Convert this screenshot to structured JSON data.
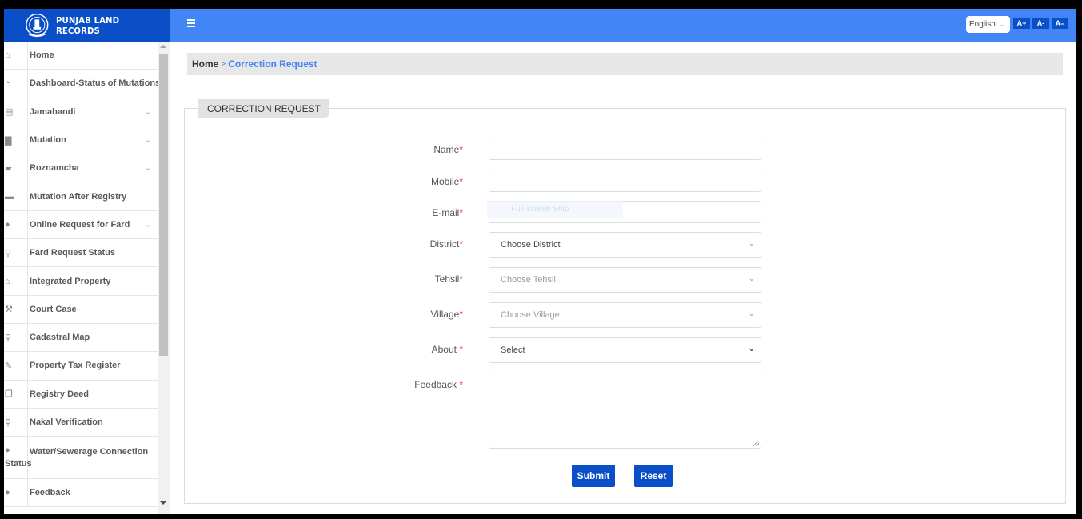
{
  "header": {
    "app_title": "PUNJAB LAND RECORDS",
    "emblem_icon": "state-emblem",
    "menu_icon": "hamburger-icon",
    "language": {
      "selected": "English",
      "icon": "chevron-down-icon"
    },
    "font_controls": [
      "A+",
      "A-",
      "A="
    ],
    "brand_color": "#0b4fc8",
    "topbar_color": "#4285f4"
  },
  "sidebar": {
    "items": [
      {
        "label": "Home",
        "icon": "home-icon",
        "glyph": "⌂",
        "has_submenu": false
      },
      {
        "label": "Dashboard-Status of Mutations",
        "icon": "dashboard-icon",
        "glyph": "◔",
        "has_submenu": false
      },
      {
        "label": "Jamabandi",
        "icon": "id-card-icon",
        "glyph": "▤",
        "has_submenu": true
      },
      {
        "label": "Mutation",
        "icon": "file-icon",
        "glyph": "▇",
        "has_submenu": true
      },
      {
        "label": "Roznamcha",
        "icon": "book-icon",
        "glyph": "▰",
        "has_submenu": true
      },
      {
        "label": "Mutation After Registry",
        "icon": "briefcase-icon",
        "glyph": "▬",
        "has_submenu": false
      },
      {
        "label": "Online Request for Fard",
        "icon": "drop-icon",
        "glyph": "●",
        "has_submenu": true
      },
      {
        "label": "Fard Request Status",
        "icon": "search-icon",
        "glyph": "⚲",
        "has_submenu": false
      },
      {
        "label": "Integrated Property",
        "icon": "bank-icon",
        "glyph": "⌂",
        "has_submenu": false
      },
      {
        "label": "Court Case",
        "icon": "gavel-icon",
        "glyph": "⚒",
        "has_submenu": false
      },
      {
        "label": "Cadastral Map",
        "icon": "map-marker-icon",
        "glyph": "⚲",
        "has_submenu": false
      },
      {
        "label": "Property Tax Register",
        "icon": "edit-icon",
        "glyph": "✎",
        "has_submenu": false
      },
      {
        "label": "Registry Deed",
        "icon": "copy-icon",
        "glyph": "❐",
        "has_submenu": false
      },
      {
        "label": "Nakal Verification",
        "icon": "search-icon",
        "glyph": "⚲",
        "has_submenu": false
      },
      {
        "label": "Water/Sewerage Connection",
        "label_wrap": "Status",
        "icon": "drop-icon",
        "glyph": "●",
        "has_submenu": false
      },
      {
        "label": "Feedback",
        "icon": "comments-icon",
        "glyph": "●",
        "has_submenu": false
      }
    ],
    "submenu_chevron": "⌄"
  },
  "breadcrumb": {
    "home": "Home",
    "separator": ">",
    "current": "Correction Request"
  },
  "form": {
    "legend": "CORRECTION REQUEST",
    "required_mark": "*",
    "fields": {
      "name": {
        "label": "Name",
        "value": ""
      },
      "mobile": {
        "label": "Mobile",
        "value": ""
      },
      "email": {
        "label": "E-mail",
        "value": ""
      },
      "district": {
        "label": "District",
        "selected": "Choose District"
      },
      "tehsil": {
        "label": "Tehsil",
        "selected": "Choose Tehsil"
      },
      "village": {
        "label": "Village",
        "selected": "Choose Village"
      },
      "about": {
        "label": "About ",
        "selected": "Select"
      },
      "feedback": {
        "label": "Feedback ",
        "value": ""
      }
    },
    "buttons": {
      "submit": "Submit",
      "reset": "Reset"
    },
    "overlay_text": "Full-screen Snip"
  }
}
